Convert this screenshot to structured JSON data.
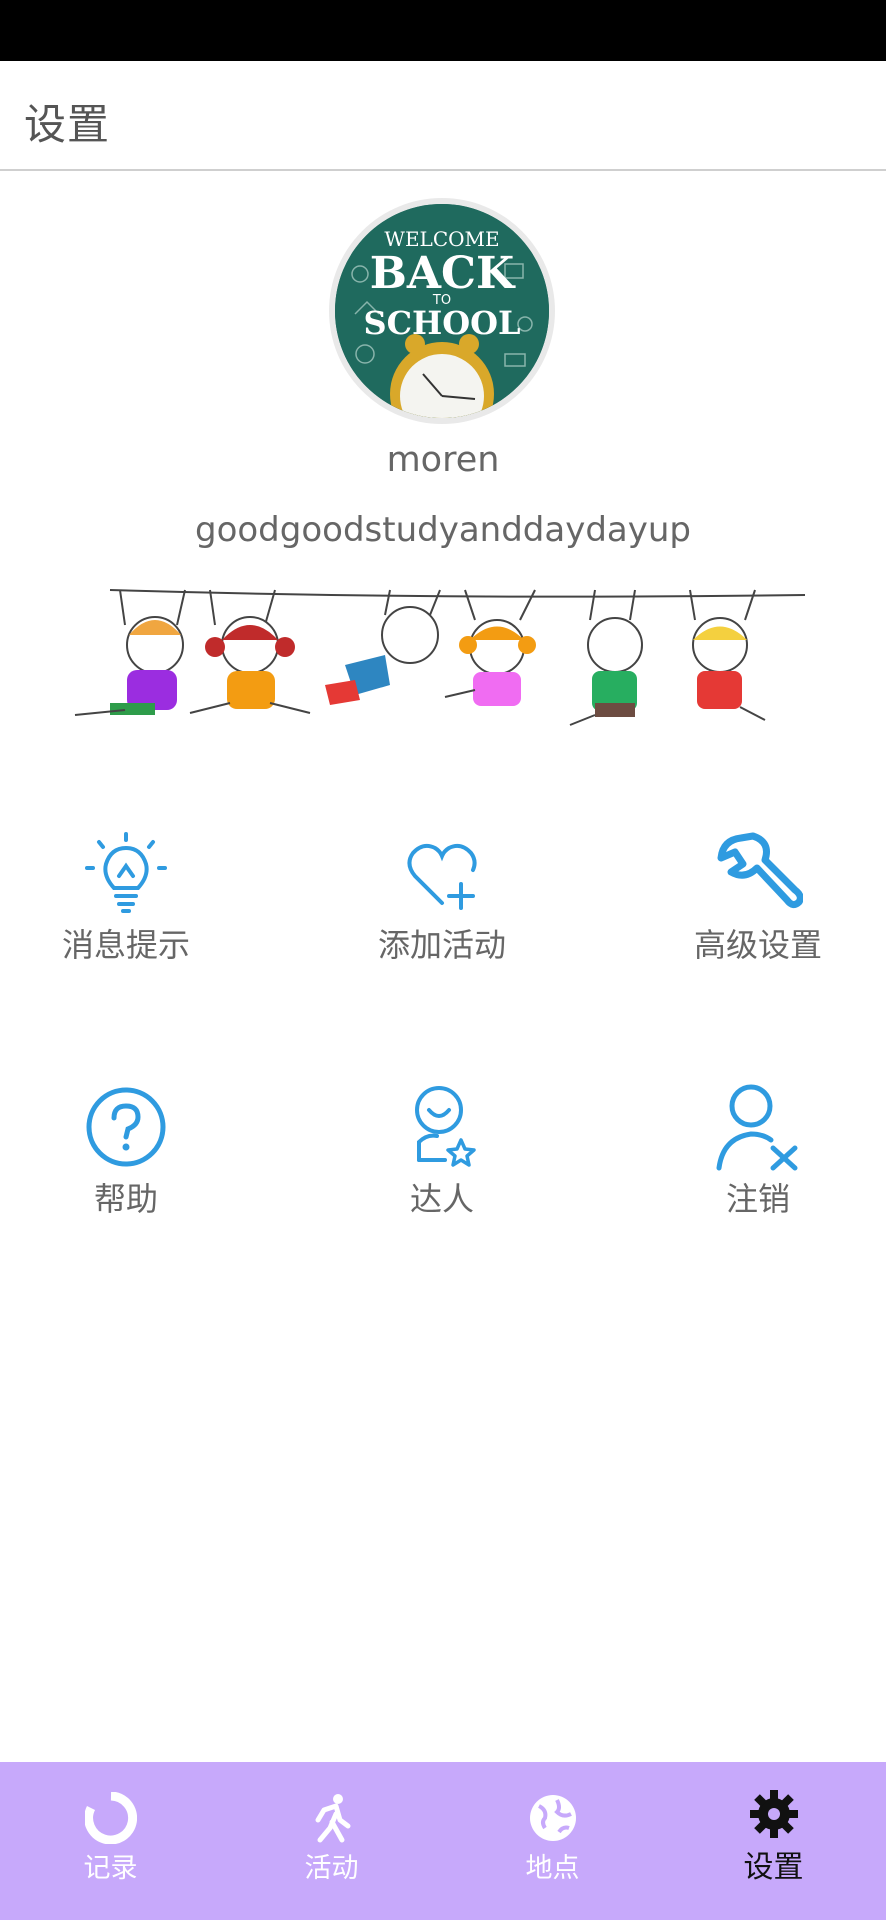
{
  "header": {
    "title": "设置"
  },
  "profile": {
    "username": "moren",
    "motto": "goodgoodstudyanddaydayup",
    "avatar_text": [
      "WELCOME",
      "BACK",
      "TO",
      "SCHOOL"
    ]
  },
  "menu": [
    {
      "label": "消息提示",
      "icon": "lightbulb-icon"
    },
    {
      "label": "添加活动",
      "icon": "heart-plus-icon"
    },
    {
      "label": "高级设置",
      "icon": "wrench-icon"
    },
    {
      "label": "帮助",
      "icon": "help-icon"
    },
    {
      "label": "达人",
      "icon": "user-star-icon"
    },
    {
      "label": "注销",
      "icon": "user-remove-icon"
    }
  ],
  "tabs": [
    {
      "label": "记录",
      "icon": "record-ring-icon"
    },
    {
      "label": "活动",
      "icon": "running-icon"
    },
    {
      "label": "地点",
      "icon": "globe-icon"
    },
    {
      "label": "设置",
      "icon": "gear-icon",
      "active": true
    }
  ],
  "colors": {
    "accent_blue": "#2f9be0",
    "tabbar_bg": "#c7a9fb",
    "header_text": "#555555",
    "status_bar": "#000000"
  }
}
